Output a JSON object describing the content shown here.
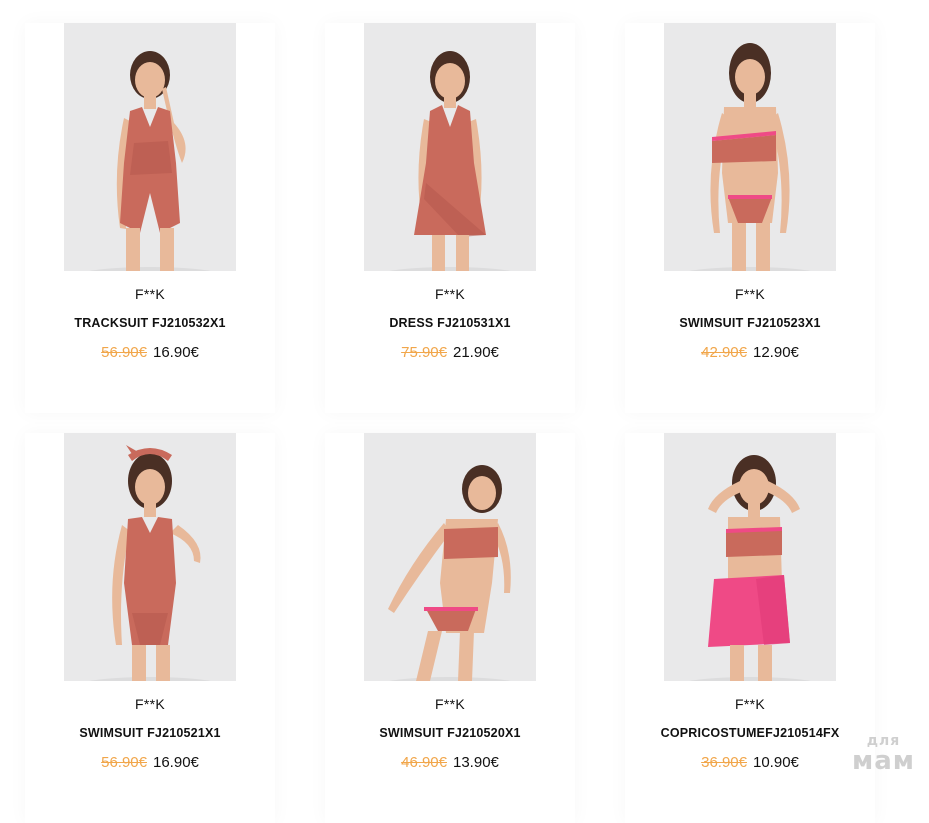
{
  "products": [
    {
      "brand": "F**K",
      "name": "TRACKSUIT FJ210532X1",
      "old_price": "56.90€",
      "price": "16.90€",
      "photo_icon": "girl-in-wrap-romper-photo"
    },
    {
      "brand": "F**K",
      "name": "DRESS FJ210531X1",
      "old_price": "75.90€",
      "price": "21.90€",
      "photo_icon": "girl-in-wrap-dress-photo"
    },
    {
      "brand": "F**K",
      "name": "SWIMSUIT FJ210523X1",
      "old_price": "42.90€",
      "price": "12.90€",
      "photo_icon": "girl-in-bandeau-bikini-photo"
    },
    {
      "brand": "F**K",
      "name": "SWIMSUIT FJ210521X1",
      "old_price": "56.90€",
      "price": "16.90€",
      "photo_icon": "girl-in-one-piece-swimsuit-photo"
    },
    {
      "brand": "F**K",
      "name": "SWIMSUIT FJ210520X1",
      "old_price": "46.90€",
      "price": "13.90€",
      "photo_icon": "girl-in-bikini-photo"
    },
    {
      "brand": "F**K",
      "name": "COPRICOSTUMEFJ210514FX",
      "old_price": "36.90€",
      "price": "10.90€",
      "photo_icon": "girl-in-pink-skirt-photo"
    }
  ],
  "watermark": {
    "small": "для",
    "big": "мам"
  },
  "colors": {
    "old_price": "#f1a64a",
    "print_fabric": "#c96a5c",
    "pink_fabric": "#ef4a86",
    "skin": "#e8b99a",
    "hair": "#4a2f24",
    "photo_bg": "#e9e9ea"
  }
}
